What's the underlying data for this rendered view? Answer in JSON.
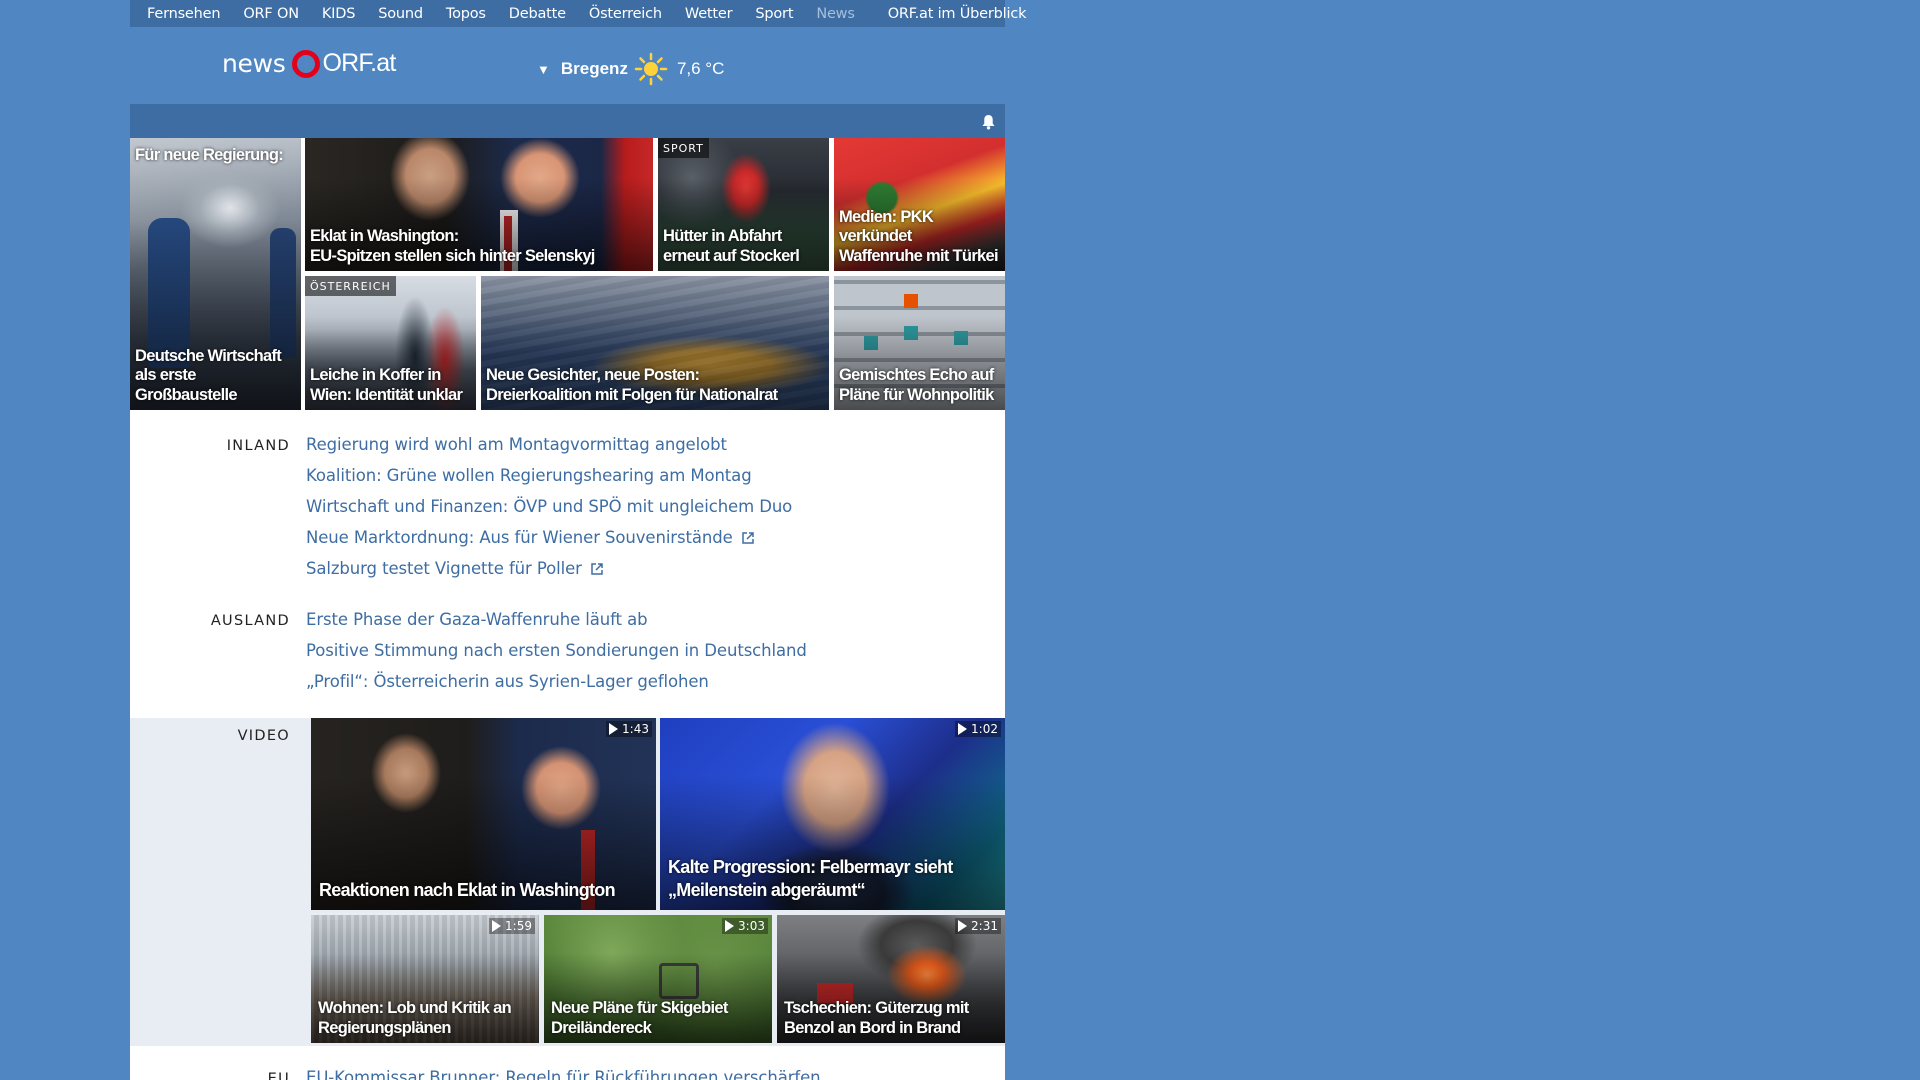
{
  "topnav": {
    "items": [
      "Fernsehen",
      "ORF ON",
      "KIDS",
      "Sound",
      "Topos",
      "Debatte",
      "Österreich",
      "Wetter",
      "Sport",
      "News"
    ],
    "active": "News",
    "overview": "ORF.at im Überblick"
  },
  "logo": {
    "news": "news",
    "orf": "ORF.at"
  },
  "weather": {
    "caret": "▼",
    "location": "Bregenz",
    "icon": "sun-icon",
    "temperature": "7,6 °C"
  },
  "toolbar": {
    "icon": "bell-icon"
  },
  "colors": {
    "page_bg": "#5087c2",
    "nav_bg": "#3e6da3",
    "link": "#3e6da3",
    "logo_ring": "#e3001b",
    "video_band": "#e8edf3"
  },
  "top_stories": [
    {
      "overlay": "Für neue Regierung:",
      "title": "Deutsche Wirtschaft\nals erste Großbaustelle",
      "badge": ""
    },
    {
      "title": "Eklat in Washington:\nEU-Spitzen stellen sich hinter Selenskyj",
      "badge": ""
    },
    {
      "title": "Hütter in Abfahrt\nerneut auf Stockerl",
      "badge": "SPORT"
    },
    {
      "title": "Medien: PKK verkündet\nWaffenruhe mit Türkei",
      "badge": ""
    },
    {
      "title": "Leiche in Koffer in\nWien: Identität unklar",
      "badge": "ÖSTERREICH"
    },
    {
      "title": "Neue Gesichter, neue Posten:\nDreierkoalition mit Folgen für Nationalrat",
      "badge": ""
    },
    {
      "title": "Gemischtes Echo auf\nPläne für Wohnpolitik",
      "badge": ""
    }
  ],
  "inland": {
    "label": "INLAND",
    "links": [
      {
        "text": "Regierung wird wohl am Montagvormittag angelobt",
        "external": false
      },
      {
        "text": "Koalition: Grüne wollen Regierungshearing am Montag",
        "external": false
      },
      {
        "text": "Wirtschaft und Finanzen: ÖVP und SPÖ mit ungleichem Duo",
        "external": false
      },
      {
        "text": "Neue Marktordnung: Aus für Wiener Souvenirstände",
        "external": true
      },
      {
        "text": "Salzburg testet Vignette für Poller",
        "external": true
      }
    ]
  },
  "ausland": {
    "label": "AUSLAND",
    "links": [
      {
        "text": "Erste Phase der Gaza-Waffenruhe läuft ab"
      },
      {
        "text": "Positive Stimmung nach ersten Sondierungen in Deutschland"
      },
      {
        "text": "„Profil“: Österreicherin aus Syrien-Lager geflohen"
      }
    ]
  },
  "video": {
    "label": "VIDEO",
    "items": [
      {
        "title": "Reaktionen nach Eklat in Washington",
        "duration": "1:43"
      },
      {
        "title": "Kalte Progression: Felbermayr sieht\n„Meilenstein abgeräumt“",
        "duration": "1:02"
      },
      {
        "title": "Wohnen: Lob und Kritik an\nRegierungsplänen",
        "duration": "1:59"
      },
      {
        "title": "Neue Pläne für Skigebiet\nDreiländereck",
        "duration": "3:03"
      },
      {
        "title": "Tschechien: Güterzug mit\nBenzol an Bord in Brand",
        "duration": "2:31"
      }
    ]
  },
  "eu": {
    "label": "EU",
    "links": [
      {
        "text": "EU-Kommissar Brunner: Regeln für Rückführungen verschärfen"
      }
    ]
  }
}
